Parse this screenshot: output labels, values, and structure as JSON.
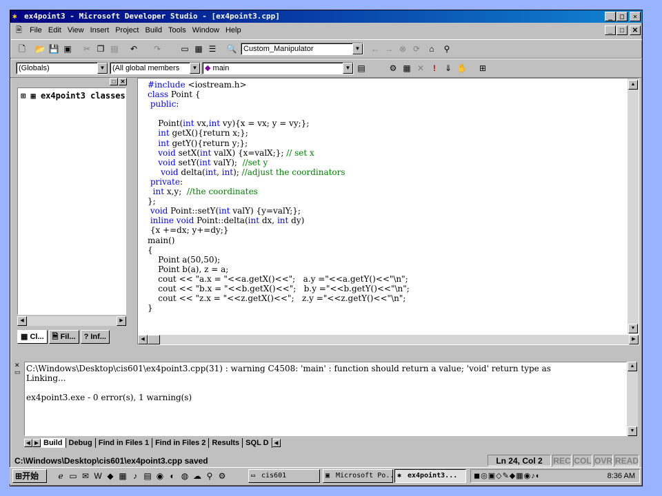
{
  "window": {
    "title": "ex4point3 - Microsoft Developer Studio - [ex4point3.cpp]",
    "min_glyph": "_",
    "max_glyph": "□",
    "close_glyph": "✕"
  },
  "menu": [
    "File",
    "Edit",
    "View",
    "Insert",
    "Project",
    "Build",
    "Tools",
    "Window",
    "Help"
  ],
  "toolbar": {
    "config_combo": "Custom_Manipulator",
    "scope_combo": "(Globals)",
    "members_combo": "(All global members",
    "function_combo": "main",
    "dropdown_glyph": "▼"
  },
  "workspace": {
    "tree_item": "ex4point3 classes",
    "tabs": [
      "Cl...",
      "Fil...",
      "Inf..."
    ]
  },
  "editor": {
    "lines": [
      "#include <iostream.h>",
      "class Point {",
      " public:",
      "",
      "    Point(int vx,int vy){x = vx; y = vy;};",
      "    int getX(){return x;};",
      "    int getY(){return y;};",
      "    void setX(int valX) {x=valX;}; // set x",
      "    void setY(int valY);  //set y",
      "     void delta(int, int); //adjust the coordinators",
      " private:",
      "  int x,y;  //the coordinates",
      "};",
      " void Point::setY(int valY) {y=valY;};",
      " inline void Point::delta(int dx, int dy)",
      " {x +=dx; y+=dy;}",
      "main()",
      "{",
      "    Point a(50,50);",
      "    Point b(a), z = a;",
      "    cout << \"a.x = \"<<a.getX()<<\";   a.y =\"<<a.getY()<<\"\\n\";",
      "    cout << \"b.x = \"<<b.getX()<<\";   b.y =\"<<b.getY()<<\"\\n\";",
      "    cout << \"z.x = \"<<z.getX()<<\";   z.y =\"<<z.getY()<<\"\\n\";",
      "}"
    ]
  },
  "output": {
    "lines": [
      "C:\\Windows\\Desktop\\cis601\\ex4point3.cpp(31) : warning C4508: 'main' : function should return a value; 'void' return type as",
      "Linking...",
      "",
      "ex4point3.exe - 0 error(s), 1 warning(s)"
    ],
    "tabs": [
      "Build",
      "Debug",
      "Find in Files 1",
      "Find in Files 2",
      "Results",
      "SQL D"
    ]
  },
  "status": {
    "message": "C:\\Windows\\Desktop\\cis601\\ex4point3.cpp saved",
    "position": "Ln 24, Col 2",
    "rec": "REC",
    "col": "COL",
    "ovr": "OVR",
    "read": "READ"
  },
  "taskbar": {
    "start_label": "开始",
    "tasks": [
      "cis601",
      "Microsoft Po...",
      "ex4point3..."
    ],
    "clock": "8:36 AM"
  }
}
